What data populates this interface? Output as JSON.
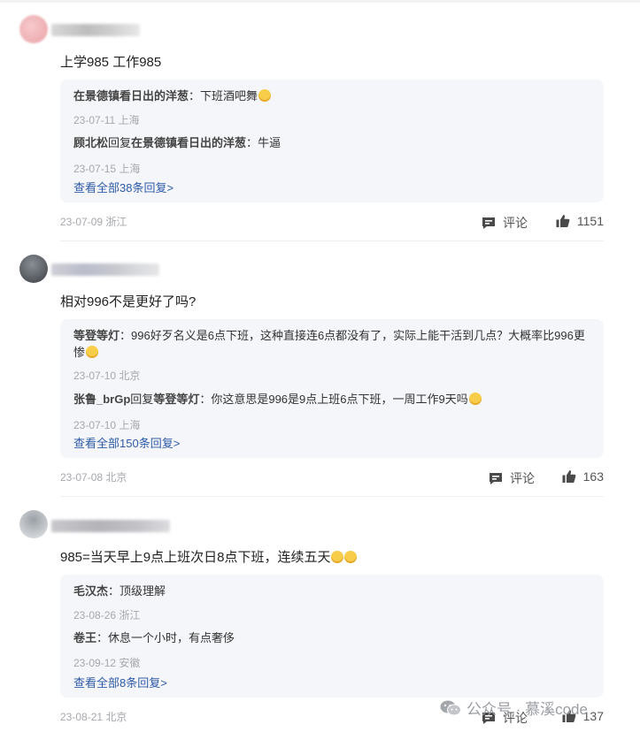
{
  "comments": [
    {
      "text": "上学985 工作985",
      "replies": [
        {
          "author": "在景德镇看日出的洋葱",
          "sep": "：",
          "text": "下班酒吧舞",
          "meta": "23-07-11 上海"
        },
        {
          "author": "顾北松",
          "reply_word": "回复",
          "target": "在景德镇看日出的洋葱",
          "sep": "：",
          "text": "牛逼",
          "meta": "23-07-15 上海"
        }
      ],
      "more": "查看全部38条回复>",
      "meta": "23-07-09 浙江",
      "comment_label": "评论",
      "likes": "1151"
    },
    {
      "text": "相对996不是更好了吗?",
      "replies": [
        {
          "author": "等登等灯",
          "sep": "：",
          "text": "996好歹名义是6点下班，这种直接连6点都没有了，实际上能干活到几点？大概率比996更惨",
          "meta": "23-07-10 北京"
        },
        {
          "author": "张鲁_brGp",
          "reply_word": "回复",
          "target": "等登等灯",
          "sep": "：",
          "text": "你这意思是996是9点上班6点下班，一周工作9天吗",
          "meta": "23-07-10 上海"
        }
      ],
      "more": "查看全部150条回复>",
      "meta": "23-07-08 北京",
      "comment_label": "评论",
      "likes": "163"
    },
    {
      "text": "985=当天早上9点上班次日8点下班，连续五天",
      "replies": [
        {
          "author": "毛汉杰",
          "sep": "：",
          "text": "顶级理解",
          "meta": "23-08-26 浙江"
        },
        {
          "author": "卷王",
          "sep": "：",
          "text": "休息一个小时，有点奢侈",
          "meta": "23-09-12 安徽"
        }
      ],
      "more": "查看全部8条回复>",
      "meta": "23-08-21 北京",
      "comment_label": "评论",
      "likes": "137"
    }
  ],
  "watermark": {
    "text": "公众号 · 慕溪code",
    "icon": "wechat-icon"
  },
  "colors": {
    "reply_bg": "#f5f6f9",
    "link": "#2e5aa8",
    "meta": "#a6a8ad"
  }
}
